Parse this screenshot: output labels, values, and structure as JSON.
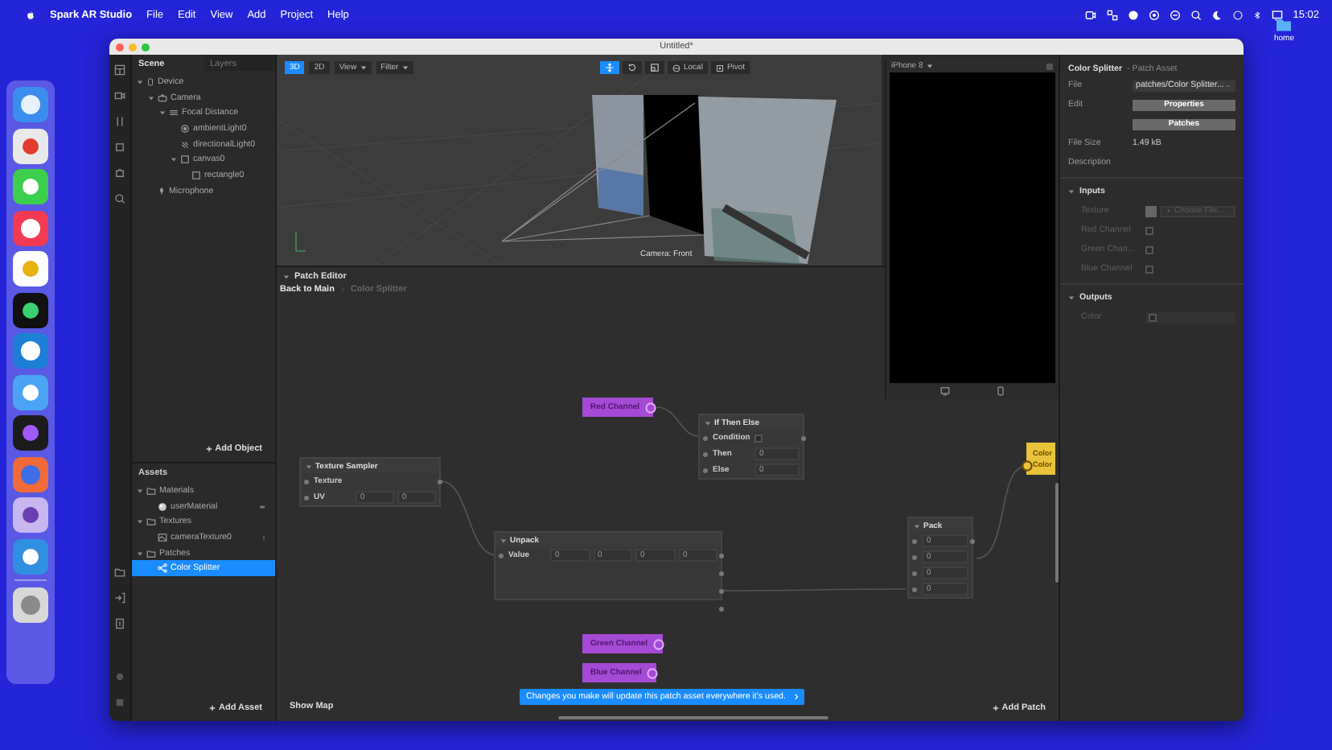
{
  "menu_bar": {
    "app_name": "Spark AR Studio",
    "menus": [
      "File",
      "Edit",
      "View",
      "Add",
      "Project",
      "Help"
    ],
    "clock": "15:02"
  },
  "desktop": {
    "folder_label": "home"
  },
  "window": {
    "title": "Untitled*"
  },
  "scene_panel": {
    "tabs": [
      {
        "label": "Scene",
        "selected": true
      },
      {
        "label": "Layers",
        "selected": false
      }
    ],
    "tree": [
      {
        "label": "Device",
        "kind": "device",
        "selected": false,
        "expanded": true,
        "children": [
          {
            "label": "Camera",
            "kind": "camera",
            "selected": false,
            "expanded": true,
            "children": [
              {
                "label": "Focal Distance",
                "kind": "plane",
                "selected": false,
                "expanded": true,
                "children": [
                  {
                    "label": "ambientLight0",
                    "kind": "ambient",
                    "selected": false
                  },
                  {
                    "label": "directionalLight0",
                    "kind": "directional",
                    "selected": false
                  },
                  {
                    "label": "canvas0",
                    "kind": "square",
                    "selected": false,
                    "expanded": true,
                    "children": [
                      {
                        "label": "rectangle0",
                        "kind": "square",
                        "selected": false
                      }
                    ]
                  }
                ]
              }
            ]
          },
          {
            "label": "Microphone",
            "kind": "mic",
            "selected": false
          }
        ]
      }
    ],
    "add_button": "Add Object"
  },
  "assets_panel": {
    "title": "Assets",
    "tree": [
      {
        "label": "Materials",
        "kind": "folder",
        "selected": false,
        "expanded": true,
        "children": [
          {
            "label": "userMaterial",
            "kind": "material",
            "selected": false
          }
        ]
      },
      {
        "label": "Textures",
        "kind": "folder",
        "selected": false,
        "expanded": true,
        "children": [
          {
            "label": "cameraTexture0",
            "kind": "texture",
            "selected": false
          }
        ]
      },
      {
        "label": "Patches",
        "kind": "folder",
        "selected": false,
        "expanded": true,
        "children": [
          {
            "label": "Color Splitter",
            "kind": "patch",
            "selected": true
          }
        ]
      }
    ],
    "add_button": "Add Asset"
  },
  "viewport": {
    "view_modes": [
      {
        "label": "3D",
        "selected": true
      },
      {
        "label": "2D",
        "selected": false
      }
    ],
    "dropdowns": [
      "View",
      "Filter"
    ],
    "transform_tools": [
      {
        "kind": "move",
        "selected": true
      },
      {
        "kind": "rotate",
        "selected": false
      },
      {
        "kind": "scale",
        "selected": false
      }
    ],
    "space_buttons": [
      "Local",
      "Pivot"
    ],
    "camera_label": "Camera: Front"
  },
  "simulator": {
    "device": "iPhone 8"
  },
  "patch_editor": {
    "title": "Patch Editor",
    "breadcrumb": [
      "Back to Main",
      "Color Splitter"
    ],
    "nodes": [
      {
        "kind": "channel",
        "label": "Red Channel"
      },
      {
        "kind": "patch",
        "title": "If Then Else",
        "rows": [
          {
            "label": "Condition",
            "kind": "checkbox",
            "checked": false
          },
          {
            "label": "Then",
            "values": [
              "0"
            ]
          },
          {
            "label": "Else",
            "values": [
              "0"
            ]
          }
        ]
      },
      {
        "kind": "patch",
        "title": "Texture Sampler",
        "rows": [
          {
            "label": "Texture"
          },
          {
            "label": "UV",
            "values": [
              "0",
              "0"
            ]
          }
        ]
      },
      {
        "kind": "patch",
        "title": "Unpack",
        "rows": [
          {
            "label": "Value",
            "values": [
              "0",
              "0",
              "0",
              "0"
            ]
          }
        ]
      },
      {
        "kind": "patch",
        "title": "Pack",
        "rows": [
          {
            "values": [
              "0"
            ]
          },
          {
            "values": [
              "0"
            ]
          },
          {
            "values": [
              "0"
            ]
          },
          {
            "values": [
              "0"
            ]
          }
        ]
      },
      {
        "kind": "output",
        "labels": [
          "Color",
          "Color"
        ]
      },
      {
        "kind": "channel",
        "label": "Green Channel"
      },
      {
        "kind": "channel",
        "label": "Blue Channel"
      }
    ],
    "toast": "Changes you make will update this patch asset everywhere it's used.",
    "show_map": "Show Map",
    "add_button": "Add Patch"
  },
  "inspector": {
    "title": "Color Splitter",
    "subtitle": "- Patch Asset",
    "file_label": "File",
    "file_value": "patches/Color Splitter...",
    "edit_label": "Edit",
    "edit_buttons": [
      "Properties",
      "Patches"
    ],
    "size_label": "File Size",
    "size_value": "1.49 kB",
    "description_label": "Description",
    "sections": [
      {
        "title": "Inputs",
        "expanded": true,
        "rows": [
          {
            "label": "Texture",
            "kind": "texture",
            "button": "Choose File...",
            "disabled": true
          },
          {
            "label": "Red Channel",
            "kind": "checkbox",
            "checked": false,
            "disabled": true
          },
          {
            "label": "Green Chan...",
            "kind": "checkbox",
            "checked": false,
            "disabled": true
          },
          {
            "label": "Blue Channel",
            "kind": "checkbox",
            "checked": false,
            "disabled": true
          }
        ]
      },
      {
        "title": "Outputs",
        "expanded": true,
        "rows": [
          {
            "label": "Color",
            "kind": "color",
            "disabled": true
          }
        ]
      }
    ]
  }
}
